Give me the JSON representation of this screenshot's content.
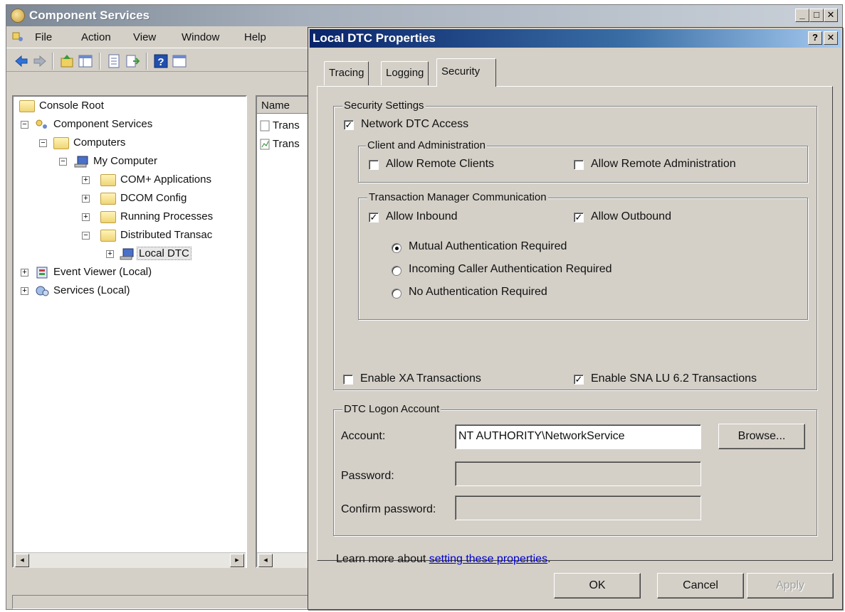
{
  "main_window": {
    "title": "Component Services",
    "controls": {
      "minimize": "_",
      "maximize": "□",
      "close": "✕"
    },
    "menu": [
      "File",
      "Action",
      "View",
      "Window",
      "Help"
    ]
  },
  "tree": {
    "items": [
      {
        "label": "Console Root"
      },
      {
        "label": "Component Services",
        "expander": "−"
      },
      {
        "label": "Computers",
        "expander": "−"
      },
      {
        "label": "My Computer",
        "expander": "−"
      },
      {
        "label": "COM+ Applications",
        "expander": "+"
      },
      {
        "label": "DCOM Config",
        "expander": "+"
      },
      {
        "label": "Running Processes",
        "expander": "+"
      },
      {
        "label": "Distributed Transac",
        "expander": "−"
      },
      {
        "label": "Local DTC",
        "expander": "+"
      },
      {
        "label": "Event Viewer (Local)",
        "expander": "+"
      },
      {
        "label": "Services (Local)",
        "expander": "+"
      }
    ]
  },
  "list": {
    "header": "Name",
    "items": [
      "Trans",
      "Trans"
    ]
  },
  "scroll": {
    "left": "◂",
    "right": "▸"
  },
  "dialog": {
    "title": "Local DTC Properties",
    "controls": {
      "help": "?",
      "close": "✕"
    },
    "tabs": [
      "Tracing",
      "Logging",
      "Security"
    ],
    "active_tab": "Security",
    "security_settings": {
      "legend": "Security Settings",
      "network_dtc_access": {
        "label": "Network DTC Access",
        "checked": true
      },
      "client_admin": {
        "legend": "Client and Administration",
        "allow_remote_clients": {
          "label": "Allow Remote Clients",
          "checked": false
        },
        "allow_remote_admin": {
          "label": "Allow Remote Administration",
          "checked": false
        }
      },
      "tm_comm": {
        "legend": "Transaction Manager Communication",
        "allow_inbound": {
          "label": "Allow Inbound",
          "checked": true
        },
        "allow_outbound": {
          "label": "Allow Outbound",
          "checked": true
        },
        "auth_options": [
          {
            "label": "Mutual Authentication Required",
            "selected": true
          },
          {
            "label": "Incoming Caller Authentication Required",
            "selected": false
          },
          {
            "label": "No Authentication Required",
            "selected": false
          }
        ]
      },
      "enable_xa": {
        "label": "Enable XA Transactions",
        "checked": false
      },
      "enable_sna": {
        "label": "Enable SNA LU 6.2 Transactions",
        "checked": true
      }
    },
    "logon": {
      "legend": "DTC Logon Account",
      "account_label": "Account:",
      "account_value": "NT AUTHORITY\\NetworkService",
      "browse_label": "Browse...",
      "password_label": "Password:",
      "confirm_label": "Confirm password:"
    },
    "learn_more": {
      "prefix": "Learn more about ",
      "link": "setting these properties",
      "suffix": "."
    },
    "buttons": {
      "ok": "OK",
      "cancel": "Cancel",
      "apply": "Apply"
    }
  },
  "colors": {
    "dialog_title_start": "#0a246a",
    "dialog_title_end": "#a6caf0",
    "face": "#d4d0c8",
    "link": "#0000cc"
  }
}
